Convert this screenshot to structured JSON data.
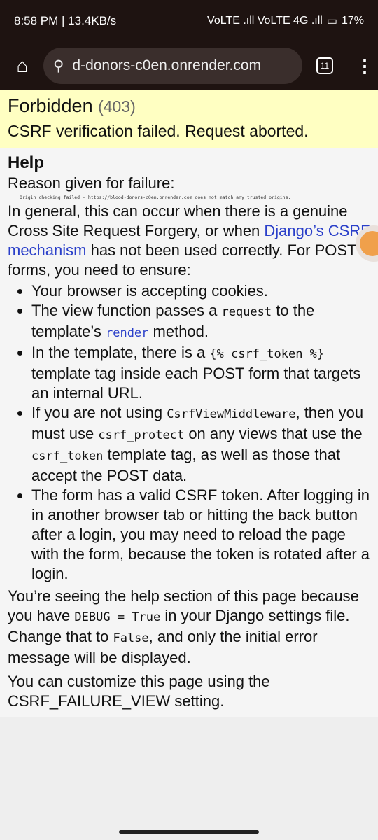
{
  "status_bar": {
    "left": "8:58 PM | 13.4KB/s",
    "signal": "VoLTE .ıll VoLTE 4G .ıll",
    "battery": "17%"
  },
  "browser": {
    "url": "d-donors-c0en.onrender.com",
    "tab_count": "11"
  },
  "summary": {
    "title": "Forbidden",
    "code": "(403)",
    "message": "CSRF verification failed. Request aborted."
  },
  "help": {
    "heading": "Help",
    "reason_label": "Reason given for failure:",
    "reason": "Origin checking failed - https://blood-donors-c0en.onrender.com does not match any trusted origins.",
    "intro_1": "In general, this can occur when there is a genuine Cross Site Request Forgery, or when ",
    "intro_link": "Django’s CSRF mechanism",
    "intro_2": " has not been used correctly. For POST forms, you need to ensure:",
    "b1": "Your browser is accepting cookies.",
    "b2a": "The view function passes a ",
    "b2c1": "request",
    "b2b": " to the template’s ",
    "b2link": "render",
    "b2c": " method.",
    "b3a": "In the template, there is a ",
    "b3c": "{% csrf_token %}",
    "b3b": " template tag inside each POST form that targets an internal URL.",
    "b4a": "If you are not using ",
    "b4c1": "CsrfViewMiddleware",
    "b4b": ", then you must use ",
    "b4c2": "csrf_protect",
    "b4d": " on any views that use the ",
    "b4c3": "csrf_token",
    "b4e": " template tag, as well as those that accept the POST data.",
    "b5": "The form has a valid CSRF token. After logging in in another browser tab or hitting the back button after a login, you may need to reload the page with the form, because the token is rotated after a login.",
    "debug_a": "You’re seeing the help section of this page because you have ",
    "debug_c1": "DEBUG = True",
    "debug_b": " in your Django settings file. Change that to ",
    "debug_c2": "False",
    "debug_c": ", and only the initial error message will be displayed.",
    "customize": "You can customize this page using the CSRF_FAILURE_VIEW setting."
  }
}
